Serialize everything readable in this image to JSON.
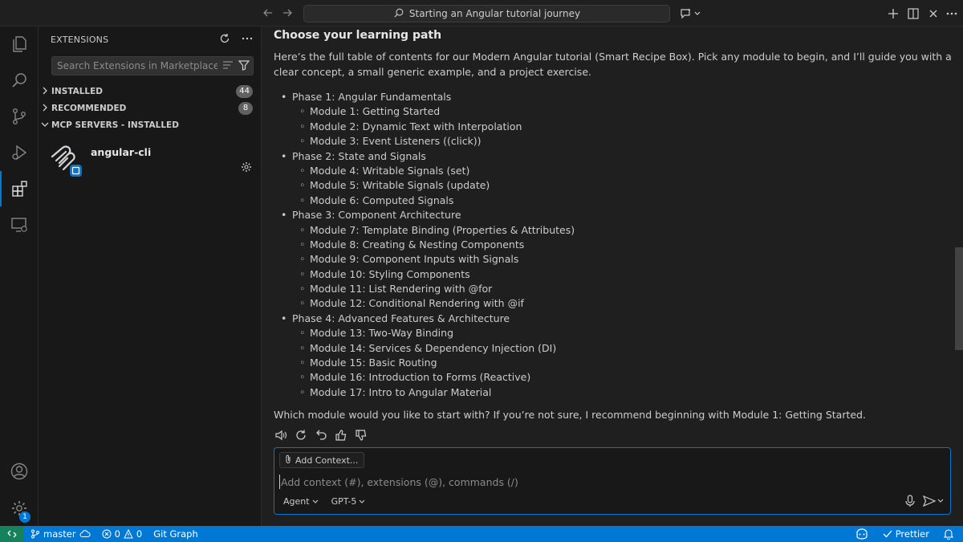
{
  "titlebar": {
    "search_text": "Starting an Angular tutorial journey",
    "back_icon": "arrow-left-icon",
    "forward_icon": "arrow-right-icon"
  },
  "activity": {
    "items": [
      "explorer",
      "search",
      "source-control",
      "run-debug",
      "extensions",
      "remote-explorer"
    ],
    "settings_badge": "1"
  },
  "sidebar": {
    "title": "EXTENSIONS",
    "search_placeholder": "Search Extensions in Marketplace",
    "sections": [
      {
        "label": "INSTALLED",
        "count": "44"
      },
      {
        "label": "RECOMMENDED",
        "count": "8"
      },
      {
        "label": "MCP SERVERS - INSTALLED"
      }
    ],
    "extension_name": "angular-cli"
  },
  "chat": {
    "heading": "Choose your learning path",
    "intro": "Here’s the full table of contents for our Modern Angular tutorial (Smart Recipe Box). Pick any module to begin, and I’ll guide you with a clear concept, a small generic example, and a project exercise.",
    "phases": [
      {
        "title": "Phase 1: Angular Fundamentals",
        "modules": [
          "Module 1: Getting Started",
          "Module 2: Dynamic Text with Interpolation",
          "Module 3: Event Listeners ((click))"
        ]
      },
      {
        "title": "Phase 2: State and Signals",
        "modules": [
          "Module 4: Writable Signals (set)",
          "Module 5: Writable Signals (update)",
          "Module 6: Computed Signals"
        ]
      },
      {
        "title": "Phase 3: Component Architecture",
        "modules": [
          "Module 7: Template Binding (Properties & Attributes)",
          "Module 8: Creating & Nesting Components",
          "Module 9: Component Inputs with Signals",
          "Module 10: Styling Components",
          "Module 11: List Rendering with @for",
          "Module 12: Conditional Rendering with @if"
        ]
      },
      {
        "title": "Phase 4: Advanced Features & Architecture",
        "modules": [
          "Module 13: Two-Way Binding",
          "Module 14: Services & Dependency Injection (DI)",
          "Module 15: Basic Routing",
          "Module 16: Introduction to Forms (Reactive)",
          "Module 17: Intro to Angular Material"
        ]
      }
    ],
    "outro": "Which module would you like to start with? If you’re not sure, I recommend beginning with Module 1: Getting Started.",
    "add_context_label": "Add Context...",
    "input_placeholder": "Add context (#), extensions (@), commands (/)",
    "mode_label": "Agent",
    "model_label": "GPT-5"
  },
  "statusbar": {
    "branch": "master",
    "errors": "0",
    "warnings": "0",
    "git_graph": "Git Graph",
    "prettier": "Prettier"
  },
  "colors": {
    "accent": "#0078d4",
    "remote": "#16825d",
    "background": "#1f1f1f",
    "sidebar": "#181818"
  }
}
